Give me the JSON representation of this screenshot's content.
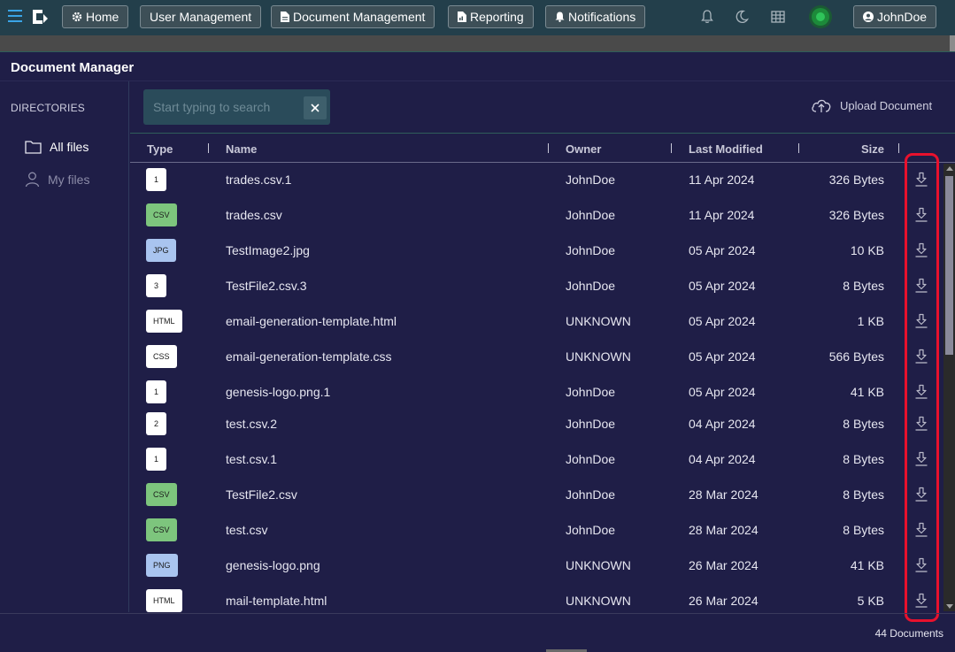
{
  "nav": {
    "home": "Home",
    "user_management": "User Management",
    "document_management": "Document Management",
    "reporting": "Reporting",
    "notifications": "Notifications",
    "user": "JohnDoe"
  },
  "header": {
    "title": "Document Manager"
  },
  "sidebar": {
    "title": "DIRECTORIES",
    "items": [
      {
        "label": "All files",
        "icon": "folder-icon"
      },
      {
        "label": "My files",
        "icon": "person-icon"
      }
    ]
  },
  "search": {
    "placeholder": "Start typing to search"
  },
  "upload": {
    "label": "Upload Document"
  },
  "table": {
    "headers": {
      "type": "Type",
      "name": "Name",
      "owner": "Owner",
      "modified": "Last Modified",
      "size": "Size"
    },
    "rows": [
      {
        "type": "1",
        "name": "trades.csv.1",
        "owner": "JohnDoe",
        "modified": "11 Apr 2024",
        "size": "326 Bytes"
      },
      {
        "type": "CSV",
        "name": "trades.csv",
        "owner": "JohnDoe",
        "modified": "11 Apr 2024",
        "size": "326 Bytes"
      },
      {
        "type": "JPG",
        "name": "TestImage2.jpg",
        "owner": "JohnDoe",
        "modified": "05 Apr 2024",
        "size": "10 KB"
      },
      {
        "type": "3",
        "name": "TestFile2.csv.3",
        "owner": "JohnDoe",
        "modified": "05 Apr 2024",
        "size": "8 Bytes"
      },
      {
        "type": "HTML",
        "name": "email-generation-template.html",
        "owner": "UNKNOWN",
        "modified": "05 Apr 2024",
        "size": "1 KB"
      },
      {
        "type": "CSS",
        "name": "email-generation-template.css",
        "owner": "UNKNOWN",
        "modified": "05 Apr 2024",
        "size": "566 Bytes"
      },
      {
        "type": "1",
        "name": "genesis-logo.png.1",
        "owner": "JohnDoe",
        "modified": "05 Apr 2024",
        "size": "41 KB"
      },
      {
        "type": "2",
        "name": "test.csv.2",
        "owner": "JohnDoe",
        "modified": "04 Apr 2024",
        "size": "8 Bytes"
      },
      {
        "type": "1",
        "name": "test.csv.1",
        "owner": "JohnDoe",
        "modified": "04 Apr 2024",
        "size": "8 Bytes"
      },
      {
        "type": "CSV",
        "name": "TestFile2.csv",
        "owner": "JohnDoe",
        "modified": "28 Mar 2024",
        "size": "8 Bytes"
      },
      {
        "type": "CSV",
        "name": "test.csv",
        "owner": "JohnDoe",
        "modified": "28 Mar 2024",
        "size": "8 Bytes"
      },
      {
        "type": "PNG",
        "name": "genesis-logo.png",
        "owner": "UNKNOWN",
        "modified": "26 Mar 2024",
        "size": "41 KB"
      },
      {
        "type": "HTML",
        "name": "mail-template.html",
        "owner": "UNKNOWN",
        "modified": "26 Mar 2024",
        "size": "5 KB"
      }
    ]
  },
  "footer": {
    "count": "44 Documents"
  },
  "colors": {
    "csv_badge": "#7dc57d",
    "image_badge": "#a9c4ef",
    "default_badge": "#ffffff",
    "highlight": "#e8112d"
  }
}
